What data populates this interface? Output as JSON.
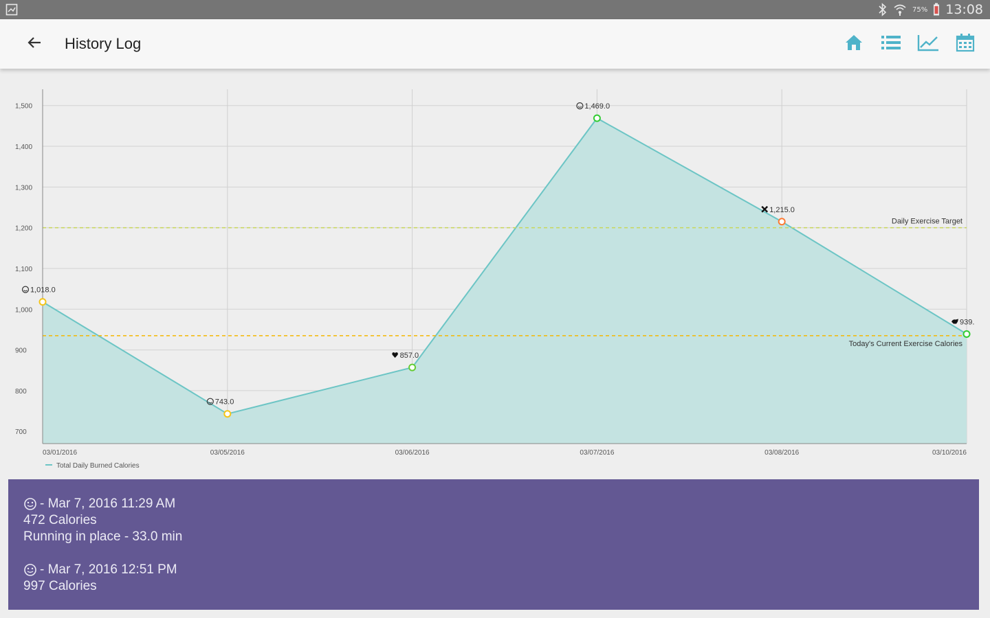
{
  "status_bar": {
    "battery": "75%",
    "time": "13:08",
    "icons": [
      "screenshot-icon",
      "bluetooth-icon",
      "wifi-icon",
      "battery-icon"
    ]
  },
  "app_bar": {
    "title": "History Log",
    "back_icon": "arrow-left-icon",
    "actions": [
      "home-icon",
      "list-icon",
      "trend-chart-icon",
      "calendar-icon"
    ],
    "accent_color": "#4fb3c9"
  },
  "chart_data": {
    "type": "area",
    "x": [
      "03/01/2016",
      "03/05/2016",
      "03/06/2016",
      "03/07/2016",
      "03/08/2016",
      "03/10/2016"
    ],
    "series": [
      {
        "name": "Total Daily Burned Calories",
        "values": [
          1018,
          743,
          857,
          1469,
          1215,
          939
        ],
        "point_labels": [
          "1,018.0",
          "743.0",
          "857.0",
          "1,469.0",
          "1,215.0",
          "939."
        ],
        "point_icons": [
          "smiley-icon",
          "smiley-icon",
          "heart-icon",
          "smiley-icon",
          "cross-icon",
          "cow-icon"
        ],
        "point_colors": [
          "#f5c518",
          "#f5c518",
          "#66cc33",
          "#33cc33",
          "#ff7a33",
          "#33cc33"
        ],
        "line_color": "#6cc5c5",
        "fill_color": "#c4e3e1"
      }
    ],
    "yticks": [
      700,
      800,
      900,
      1000,
      1100,
      1200,
      1300,
      1400,
      1500
    ],
    "ytick_labels": [
      "700",
      "800",
      "900",
      "1,000",
      "1,100",
      "1,200",
      "1,300",
      "1,400",
      "1,500"
    ],
    "ylim": [
      670,
      1540
    ],
    "limit_lines": [
      {
        "label": "Daily Exercise Target",
        "value": 1200,
        "color": "#c8d65a"
      },
      {
        "label": "Today's Current Exercise Calories",
        "value": 935,
        "color": "#f5b800"
      }
    ],
    "grid": true,
    "legend": "bottom-left"
  },
  "details_panel": {
    "background": "#635893",
    "entries": [
      {
        "icon": "smiley-icon",
        "lines": [
          "- Mar 7, 2016 11:29 AM",
          "472 Calories",
          "Running in place - 33.0 min"
        ]
      },
      {
        "icon": "smiley-icon",
        "lines": [
          "- Mar 7, 2016 12:51 PM",
          "997 Calories"
        ]
      }
    ]
  }
}
